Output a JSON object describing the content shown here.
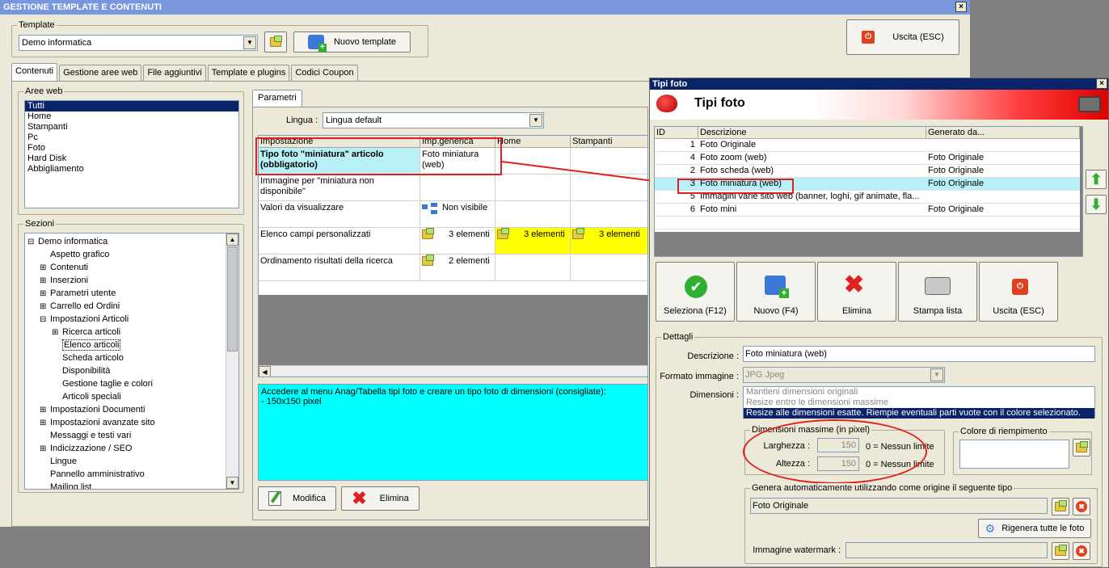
{
  "window_title": "GESTIONE TEMPLATE E CONTENUTI",
  "close_glyph": "×",
  "template": {
    "label": "Template",
    "value": "Demo informatica",
    "new_button": "Nuovo template",
    "exit_button": "Uscita (ESC)"
  },
  "tabs": [
    "Contenuti",
    "Gestione aree web",
    "File aggiuntivi",
    "Template e plugins",
    "Codici Coupon"
  ],
  "aree_web": {
    "label": "Aree web",
    "items": [
      "Tutti",
      "Home",
      "Stampanti",
      "Pc",
      "Foto",
      "Hard Disk",
      "Abbigliamento"
    ]
  },
  "sezioni": {
    "label": "Sezioni",
    "items": [
      {
        "text": "Demo informatica",
        "level": 0,
        "exp": "⊟"
      },
      {
        "text": "Aspetto grafico",
        "level": 1,
        "exp": ""
      },
      {
        "text": "Contenuti",
        "level": 1,
        "exp": "⊞"
      },
      {
        "text": "Inserzioni",
        "level": 1,
        "exp": "⊞"
      },
      {
        "text": "Parametri utente",
        "level": 1,
        "exp": "⊞"
      },
      {
        "text": "Carrello ed Ordini",
        "level": 1,
        "exp": "⊞"
      },
      {
        "text": "Impostazioni Articoli",
        "level": 1,
        "exp": "⊟"
      },
      {
        "text": "Ricerca articoli",
        "level": 2,
        "exp": "⊞"
      },
      {
        "text": "Elenco articoli",
        "level": 2,
        "exp": ""
      },
      {
        "text": "Scheda articolo",
        "level": 2,
        "exp": ""
      },
      {
        "text": "Disponibilità",
        "level": 2,
        "exp": ""
      },
      {
        "text": "Gestione taglie e colori",
        "level": 2,
        "exp": ""
      },
      {
        "text": "Articoli speciali",
        "level": 2,
        "exp": ""
      },
      {
        "text": "Impostazioni Documenti",
        "level": 1,
        "exp": "⊞"
      },
      {
        "text": "Impostazioni avanzate sito",
        "level": 1,
        "exp": "⊞"
      },
      {
        "text": "Messaggi e testi vari",
        "level": 1,
        "exp": ""
      },
      {
        "text": "Indicizzazione / SEO",
        "level": 1,
        "exp": "⊞"
      },
      {
        "text": "Lingue",
        "level": 1,
        "exp": ""
      },
      {
        "text": "Pannello amministrativo",
        "level": 1,
        "exp": ""
      },
      {
        "text": "Mailing list",
        "level": 1,
        "exp": ""
      }
    ]
  },
  "parametri": {
    "tab": "Parametri",
    "lingua_label": "Lingua :",
    "lingua_value": "Lingua default",
    "headers": [
      "Impostazione",
      "Imp.generica",
      "Home",
      "Stampanti"
    ],
    "rows": [
      {
        "name": "Tipo foto \"miniatura\" articolo (obbligatorio)",
        "generic": "Foto miniatura (web)"
      },
      {
        "name": "Immagine per \"miniatura non disponibile\"",
        "generic": ""
      },
      {
        "name": "Valori da visualizzare",
        "generic": "Non visibile"
      },
      {
        "name": "Elenco campi personalizzati",
        "generic": "3 elementi",
        "home": "3 elementi",
        "stampanti": "3 elementi"
      },
      {
        "name": "Ordinamento risultati della ricerca",
        "generic": "2 elementi"
      }
    ],
    "help_text": "Accedere al menu Anag/Tabella tipi foto e creare un tipo foto di dimensioni (consigliate):\n- 150x150 pixel",
    "modifica": "Modifica",
    "elimina": "Elimina"
  },
  "tipi_foto": {
    "window_title": "Tipi foto",
    "header": "Tipi foto",
    "columns": [
      "ID",
      "Descrizione",
      "Generato da..."
    ],
    "rows": [
      {
        "id": "1",
        "desc": "Foto Originale",
        "gen": ""
      },
      {
        "id": "4",
        "desc": "Foto zoom (web)",
        "gen": "Foto Originale"
      },
      {
        "id": "2",
        "desc": "Foto scheda (web)",
        "gen": "Foto Originale"
      },
      {
        "id": "3",
        "desc": "Foto miniatura (web)",
        "gen": "Foto Originale"
      },
      {
        "id": "5",
        "desc": "Immagini varie sito web (banner, loghi, gif animate, fla...",
        "gen": ""
      },
      {
        "id": "6",
        "desc": "Foto mini",
        "gen": "Foto Originale"
      }
    ],
    "buttons": [
      "Seleziona (F12)",
      "Nuovo (F4)",
      "Elimina",
      "Stampa lista",
      "Uscita (ESC)"
    ],
    "dettagli": {
      "label": "Dettagli",
      "descrizione_label": "Descrizione :",
      "descrizione": "Foto miniatura (web)",
      "formato_label": "Formato immagine :",
      "formato": "JPG Jpeg",
      "dimensioni_label": "Dimensioni :",
      "dimensioni_options": [
        "Mantieni dimensioni originali",
        "Resize entro le dimensioni massime",
        "Resize alle dimensioni esatte. Riempie eventuali parti vuote con il colore selezionato."
      ],
      "dim_max_label": "Dimensioni massime (in pixel)",
      "larghezza_label": "Larghezza :",
      "larghezza": "150",
      "altezza_label": "Altezza :",
      "altezza": "150",
      "nessun_limite": "0 = Nessun limite",
      "colore_label": "Colore di riempimento",
      "genera_label": "Genera automaticamente utilizzando come origine il seguente tipo",
      "genera_value": "Foto Originale",
      "rigenera": "Rigenera tutte le foto",
      "watermark_label": "Immagine watermark :"
    }
  },
  "colors": {
    "selection": "#0a246a",
    "cyan": "#00ffff",
    "yellow": "#ffff00",
    "title": "#7a96df",
    "annotation": "#e02020"
  }
}
